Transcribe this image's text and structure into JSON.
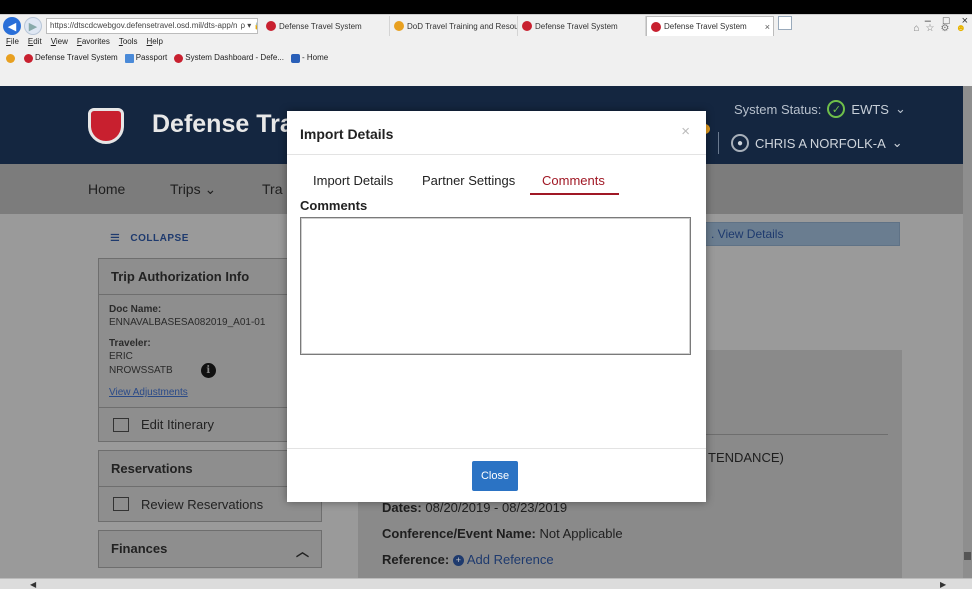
{
  "browser": {
    "address": "https://dtscdcwebgov.defensetravel.osd.mil/dts-app/n",
    "address_tail": "ρ ▾ 🔒 ↻",
    "tabs": [
      {
        "label": "Defense Travel System",
        "active": false
      },
      {
        "label": "DoD Travel Training and Resou...",
        "active": false
      },
      {
        "label": "Defense Travel System",
        "active": false
      },
      {
        "label": "Defense Travel System",
        "active": true
      }
    ],
    "menu": [
      "File",
      "Edit",
      "View",
      "Favorites",
      "Tools",
      "Help"
    ],
    "favorites": [
      "Defense Travel System",
      "Passport",
      "System Dashboard - Defe...",
      "- Home"
    ],
    "window_controls": [
      "–",
      "□",
      "×"
    ]
  },
  "header": {
    "app_title": "Defense Tra",
    "system_status_label": "System Status:",
    "system_status_value": "EWTS",
    "user_name": "CHRIS A NORFOLK-A"
  },
  "nav": {
    "items": [
      "Home",
      "Trips ⌄",
      "Tra"
    ]
  },
  "sidebar": {
    "collapse_label": "COLLAPSE",
    "trip_auth_heading": "Trip Authorization Info",
    "doc_name_label": "Doc Name:",
    "doc_name_value": "ENNAVALBASESA082019_A01-01",
    "traveler_label": "Traveler:",
    "traveler_first": "ERIC",
    "traveler_last": "NROWSSATB",
    "view_adjustments": "View Adjustments",
    "edit_itinerary": "Edit Itinerary",
    "reservations_heading": "Reservations",
    "review_reservations": "Review Reservations",
    "finances_heading": "Finances"
  },
  "main": {
    "alert_text": ". View Details",
    "attendance_text": "TENDANCE)",
    "dates_label": "Dates:",
    "dates_value": "08/20/2019 - 08/23/2019",
    "conference_label": "Conference/Event Name:",
    "conference_value": "Not Applicable",
    "reference_label": "Reference:",
    "add_reference": "Add Reference"
  },
  "modal": {
    "title": "Import Details",
    "close_glyph": "×",
    "tabs": [
      "Import Details",
      "Partner Settings",
      "Comments"
    ],
    "active_tab": "Comments",
    "comments_label": "Comments",
    "comments_value": "",
    "close_button": "Close"
  },
  "colors": {
    "accent_red": "#a01825",
    "button_blue": "#2b73c4",
    "banner_navy": "#142640",
    "status_green": "#6fbf4a"
  }
}
